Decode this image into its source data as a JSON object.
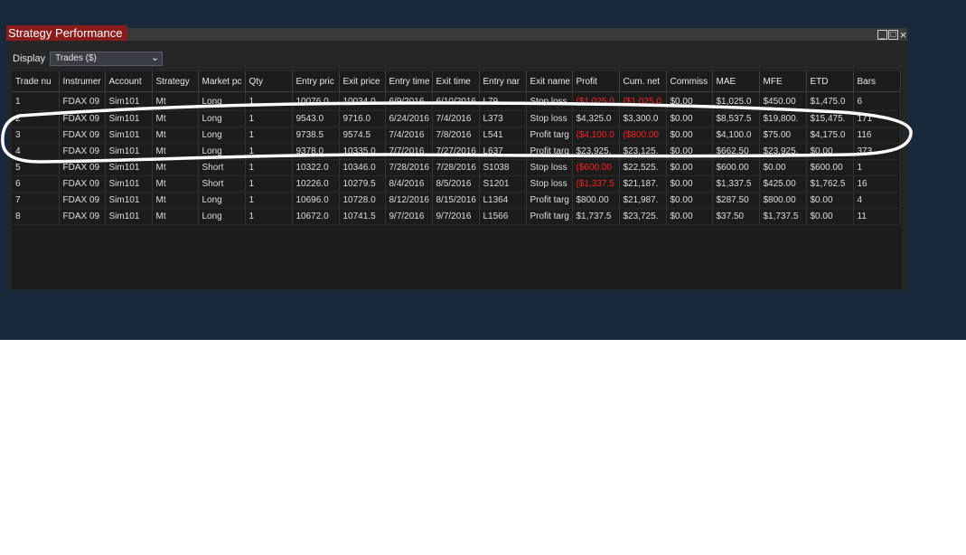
{
  "window": {
    "title": "Strategy Performance",
    "controls": [
      "_",
      "□",
      "×"
    ]
  },
  "display": {
    "label": "Display",
    "selected": "Trades ($)"
  },
  "columns": [
    "Trade nu",
    "Instrumer",
    "Account",
    "Strategy",
    "Market pc",
    "Qty",
    "Entry pric",
    "Exit price",
    "Entry time",
    "Exit time",
    "Entry nar",
    "Exit name",
    "Profit",
    "Cum. net",
    "Commiss",
    "MAE",
    "MFE",
    "ETD",
    "Bars"
  ],
  "rows": [
    [
      "1",
      "FDAX 09",
      "Sim101",
      "Mt",
      "Long",
      "1",
      "10076.0",
      "10034.0",
      "6/9/2016",
      "6/10/2016",
      "L79",
      "Stop loss",
      "($1,025.0",
      "($1,025.0",
      "$0.00",
      "$1,025.0",
      "$450.00",
      "$1,475.0",
      "6"
    ],
    [
      "2",
      "FDAX 09",
      "Sim101",
      "Mt",
      "Long",
      "1",
      "9543.0",
      "9716.0",
      "6/24/2016",
      "7/4/2016",
      "L373",
      "Stop loss",
      "$4,325.0",
      "$3,300.0",
      "$0.00",
      "$8,537.5",
      "$19,800.",
      "$15,475.",
      "171"
    ],
    [
      "3",
      "FDAX 09",
      "Sim101",
      "Mt",
      "Long",
      "1",
      "9738.5",
      "9574.5",
      "7/4/2016",
      "7/8/2016",
      "L541",
      "Profit targ",
      "($4,100.0",
      "($800.00",
      "$0.00",
      "$4,100.0",
      "$75.00",
      "$4,175.0",
      "116"
    ],
    [
      "4",
      "FDAX 09",
      "Sim101",
      "Mt",
      "Long",
      "1",
      "9378.0",
      "10335.0",
      "7/7/2016",
      "7/27/2016",
      "L637",
      "Profit targ",
      "$23,925.",
      "$23,125.",
      "$0.00",
      "$662.50",
      "$23,925.",
      "$0.00",
      "373"
    ],
    [
      "5",
      "FDAX 09",
      "Sim101",
      "Mt",
      "Short",
      "1",
      "10322.0",
      "10346.0",
      "7/28/2016",
      "7/28/2016",
      "S1038",
      "Stop loss",
      "($600.00",
      "$22,525.",
      "$0.00",
      "$600.00",
      "$0.00",
      "$600.00",
      "1"
    ],
    [
      "6",
      "FDAX 09",
      "Sim101",
      "Mt",
      "Short",
      "1",
      "10226.0",
      "10279.5",
      "8/4/2016",
      "8/5/2016",
      "S1201",
      "Stop loss",
      "($1,337.5",
      "$21,187.",
      "$0.00",
      "$1,337.5",
      "$425.00",
      "$1,762.5",
      "16"
    ],
    [
      "7",
      "FDAX 09",
      "Sim101",
      "Mt",
      "Long",
      "1",
      "10696.0",
      "10728.0",
      "8/12/2016",
      "8/15/2016",
      "L1364",
      "Profit targ",
      "$800.00",
      "$21,987.",
      "$0.00",
      "$287.50",
      "$800.00",
      "$0.00",
      "4"
    ],
    [
      "8",
      "FDAX 09",
      "Sim101",
      "Mt",
      "Long",
      "1",
      "10672.0",
      "10741.5",
      "9/7/2016",
      "9/7/2016",
      "L1566",
      "Profit targ",
      "$1,737.5",
      "$23,725.",
      "$0.00",
      "$37.50",
      "$1,737.5",
      "$0.00",
      "11"
    ]
  ],
  "colors": {
    "negative": "#ff2020",
    "title_tab": "#8b1c1c",
    "marker": "#ffffff"
  }
}
